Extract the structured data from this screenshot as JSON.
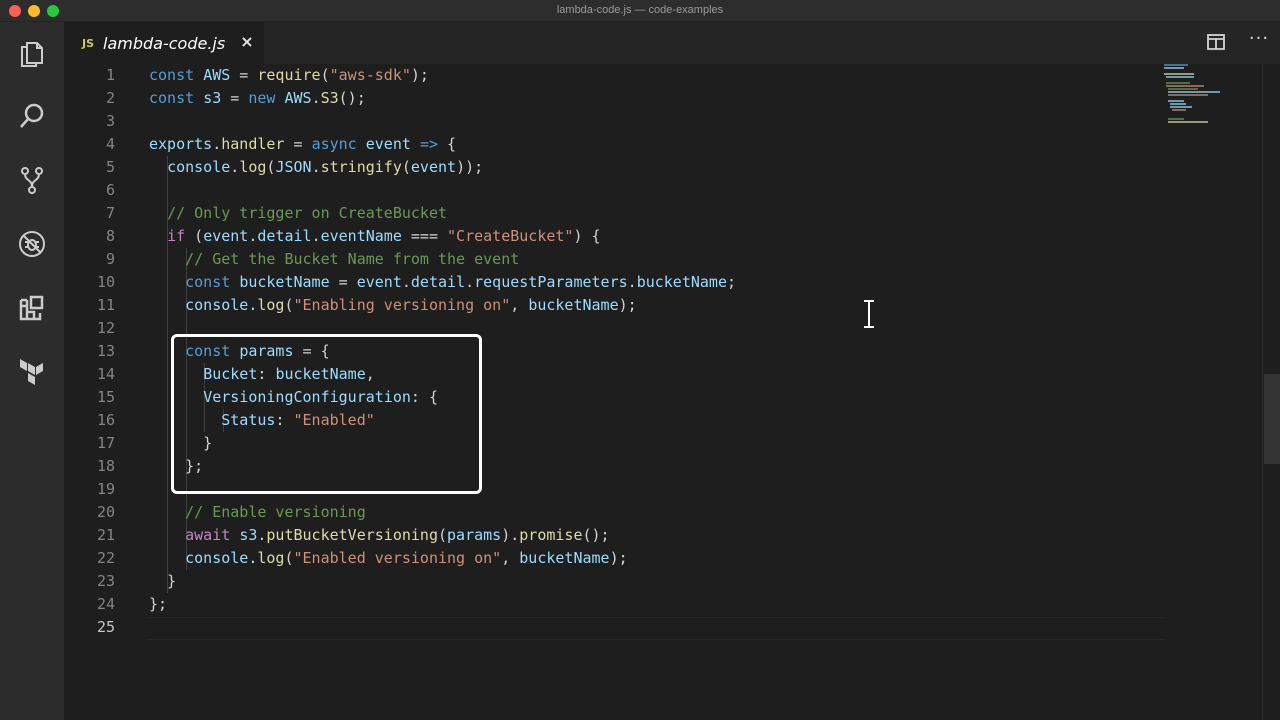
{
  "window": {
    "title": "lambda-code.js — code-examples"
  },
  "activity_bar": [
    {
      "name": "explorer-icon",
      "label": "Explorer"
    },
    {
      "name": "search-icon",
      "label": "Search"
    },
    {
      "name": "source-control-icon",
      "label": "Source Control"
    },
    {
      "name": "debug-icon",
      "label": "Debug"
    },
    {
      "name": "extensions-icon",
      "label": "Extensions"
    },
    {
      "name": "terraform-icon",
      "label": "Terraform"
    }
  ],
  "tab": {
    "lang_badge": "JS",
    "filename": "lambda-code.js",
    "close": "×"
  },
  "toolbar": {
    "more_label": "···"
  },
  "editor": {
    "active_line": 25,
    "lines": [
      "const AWS = require(\"aws-sdk\");",
      "const s3 = new AWS.S3();",
      "",
      "exports.handler = async event => {",
      "  console.log(JSON.stringify(event));",
      "",
      "  // Only trigger on CreateBucket",
      "  if (event.detail.eventName === \"CreateBucket\") {",
      "    // Get the Bucket Name from the event",
      "    const bucketName = event.detail.requestParameters.bucketName;",
      "    console.log(\"Enabling versioning on\", bucketName);",
      "",
      "    const params = {",
      "      Bucket: bucketName,",
      "      VersioningConfiguration: {",
      "        Status: \"Enabled\"",
      "      }",
      "    };",
      "",
      "    // Enable versioning",
      "    await s3.putBucketVersioning(params).promise();",
      "    console.log(\"Enabled versioning on\", bucketName);",
      "  }",
      "};",
      ""
    ]
  },
  "colors": {
    "keyword": "#569cd6",
    "function": "#dcdcaa",
    "string": "#ce9178",
    "variable": "#9cdcfe",
    "class": "#4ec9b0",
    "comment": "#6a9955",
    "control": "#c586c0",
    "highlight_box": "#ffffff"
  }
}
